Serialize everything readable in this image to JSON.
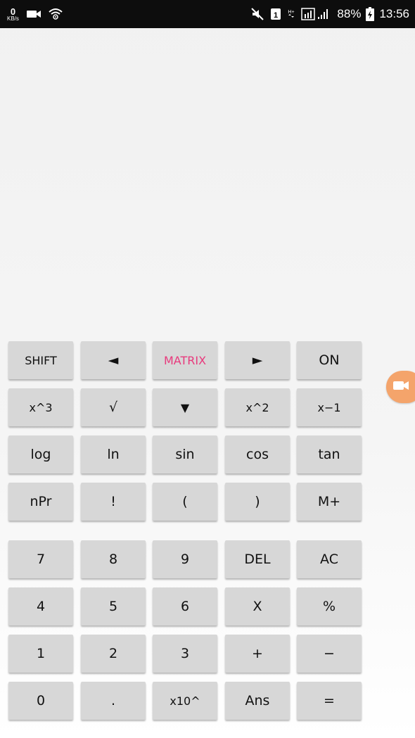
{
  "status_bar": {
    "speed_value": "0",
    "speed_unit": "KB/s",
    "battery": "88%",
    "time": "13:56"
  },
  "keypad": {
    "row1": [
      "SHIFT",
      "◄",
      "MATRIX",
      "►",
      "ON"
    ],
    "row2": [
      "x^3",
      "√",
      "▼",
      "x^2",
      "x−1"
    ],
    "row3": [
      "log",
      "ln",
      "sin",
      "cos",
      "tan"
    ],
    "row4": [
      "nPr",
      "!",
      "(",
      ")",
      "M+"
    ],
    "row5": [
      "7",
      "8",
      "9",
      "DEL",
      "AC"
    ],
    "row6": [
      "4",
      "5",
      "6",
      "X",
      "%"
    ],
    "row7": [
      "1",
      "2",
      "3",
      "+",
      "−"
    ],
    "row8": [
      "0",
      ".",
      "x10^",
      "Ans",
      "="
    ]
  },
  "colors": {
    "key_bg": "#d7d7d7",
    "matrix_accent": "#e8397c",
    "float_button": "#f4a46b",
    "status_bar_bg": "#0d0d0d"
  },
  "icons": [
    "cast-icon",
    "wifi-icon",
    "mute-icon",
    "sim-icon",
    "signal-icon",
    "battery-icon",
    "video-camera-icon"
  ]
}
